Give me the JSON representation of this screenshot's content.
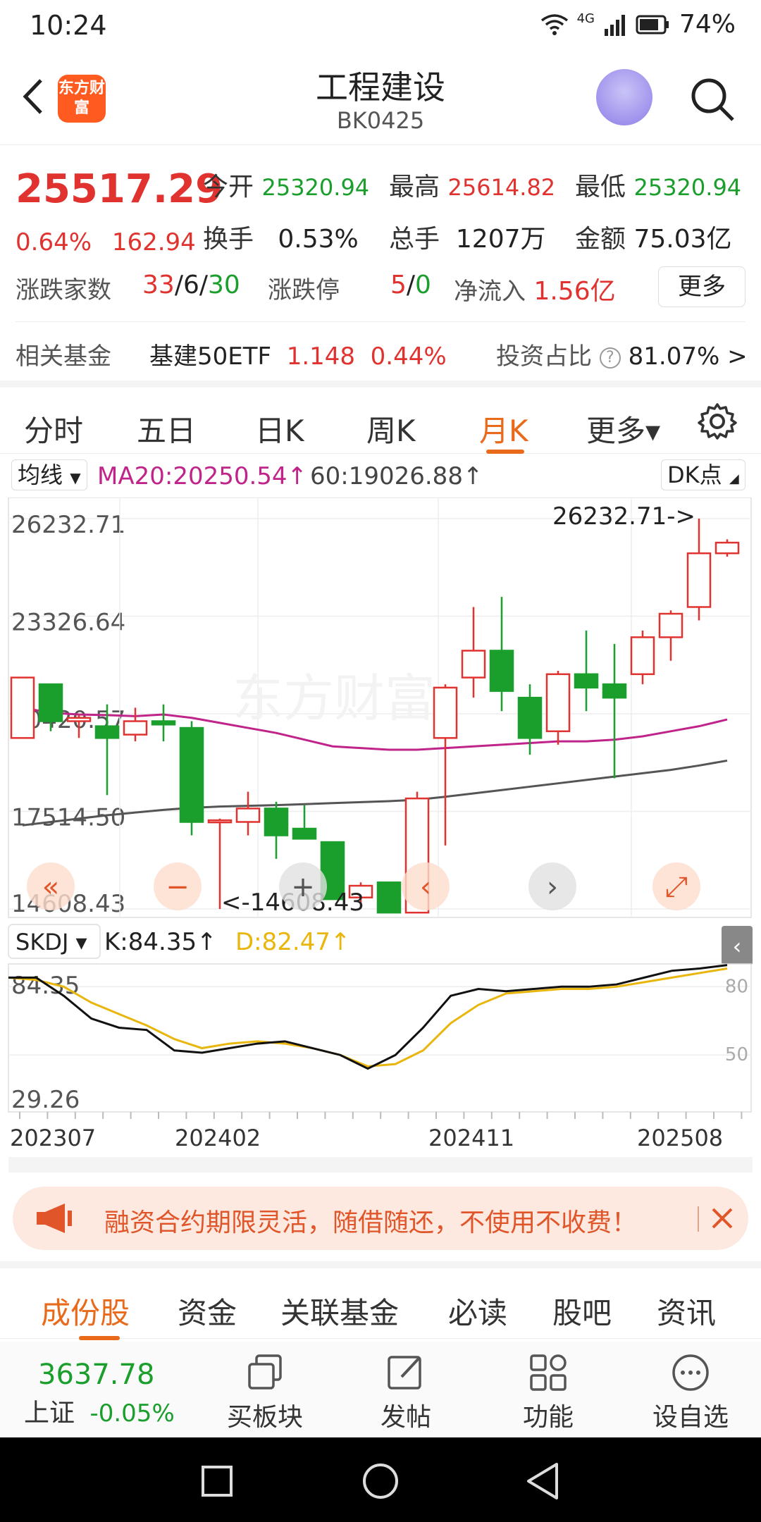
{
  "status": {
    "time": "10:24",
    "network": "4G",
    "battery": "74%"
  },
  "header": {
    "title": "工程建设",
    "code": "BK0425",
    "logo_text": "东方财富"
  },
  "quote": {
    "price": "25517.29",
    "change_pct": "0.64%",
    "change_abs": "162.94",
    "open_label": "今开",
    "open": "25320.94",
    "high_label": "最高",
    "high": "25614.82",
    "low_label": "最低",
    "low": "25320.94",
    "turnover_label": "换手",
    "turnover": "0.53%",
    "volume_label": "总手",
    "volume": "1207万",
    "amount_label": "金额",
    "amount": "75.03亿",
    "updown_label": "涨跌家数",
    "up": "33",
    "flat": "6",
    "down": "30",
    "limit_label": "涨跌停",
    "limit_up": "5",
    "limit_down": "0",
    "netflow_label": "净流入",
    "netflow": "1.56亿",
    "more_label": "更多",
    "fund_label": "相关基金",
    "fund_name": "基建50ETF",
    "fund_price": "1.148",
    "fund_pct": "0.44%",
    "invest_label": "投资占比",
    "invest_value": "81.07%"
  },
  "tabs": [
    "分时",
    "五日",
    "日K",
    "周K",
    "月K",
    "更多▾"
  ],
  "ma_bar": {
    "selector": "均线",
    "ma20": "MA20:20250.54↑",
    "ma60": "60:19026.88↑",
    "dk": "DK点"
  },
  "chart_data": {
    "type": "candlestick",
    "period": "monthly",
    "y_ticks": [
      "26232.71",
      "23326.64",
      "20420.57",
      "17514.50",
      "14608.43"
    ],
    "ylim": [
      14608.43,
      26232.71
    ],
    "x_labels": [
      "202307",
      "202402",
      "202411",
      "202508"
    ],
    "max_annotation": "26232.71->",
    "min_annotation": "<-14608.43",
    "watermark": "东方财富",
    "candles": [
      {
        "o": 19700,
        "h": 21500,
        "l": 19700,
        "c": 21500
      },
      {
        "o": 21300,
        "h": 21300,
        "l": 19900,
        "c": 20200
      },
      {
        "o": 20200,
        "h": 20400,
        "l": 19700,
        "c": 20300
      },
      {
        "o": 20050,
        "h": 20700,
        "l": 18000,
        "c": 19700
      },
      {
        "o": 19800,
        "h": 20600,
        "l": 19600,
        "c": 20200
      },
      {
        "o": 20200,
        "h": 20700,
        "l": 19600,
        "c": 20100
      },
      {
        "o": 20000,
        "h": 20200,
        "l": 16800,
        "c": 17200
      },
      {
        "o": 17200,
        "h": 17300,
        "l": 14608.43,
        "c": 17250
      },
      {
        "o": 17200,
        "h": 18100,
        "l": 16800,
        "c": 17600
      },
      {
        "o": 17600,
        "h": 17800,
        "l": 16100,
        "c": 16800
      },
      {
        "o": 17000,
        "h": 17700,
        "l": 16700,
        "c": 16700
      },
      {
        "o": 16600,
        "h": 16600,
        "l": 14900,
        "c": 14900
      },
      {
        "o": 14950,
        "h": 15400,
        "l": 14700,
        "c": 15300
      },
      {
        "o": 15400,
        "h": 15400,
        "l": 14700,
        "c": 14500
      },
      {
        "o": 14500,
        "h": 18100,
        "l": 14608.43,
        "c": 17900
      },
      {
        "o": 19700,
        "h": 21300,
        "l": 16500,
        "c": 21200
      },
      {
        "o": 21500,
        "h": 23600,
        "l": 20900,
        "c": 22300
      },
      {
        "o": 22300,
        "h": 23900,
        "l": 20500,
        "c": 21100
      },
      {
        "o": 20900,
        "h": 21300,
        "l": 19200,
        "c": 19700
      },
      {
        "o": 19900,
        "h": 21700,
        "l": 19500,
        "c": 21600
      },
      {
        "o": 21600,
        "h": 22900,
        "l": 20500,
        "c": 21200
      },
      {
        "o": 21300,
        "h": 22500,
        "l": 18500,
        "c": 20900
      },
      {
        "o": 21600,
        "h": 22900,
        "l": 21300,
        "c": 22700
      },
      {
        "o": 22700,
        "h": 23500,
        "l": 22000,
        "c": 23400
      },
      {
        "o": 23600,
        "h": 26232.71,
        "l": 23200,
        "c": 25200
      },
      {
        "o": 25200,
        "h": 25614.82,
        "l": 25100,
        "c": 25517.29
      }
    ],
    "ma20": [
      20600,
      20450,
      20400,
      20380,
      20350,
      20400,
      20300,
      20150,
      20000,
      19850,
      19650,
      19450,
      19400,
      19350,
      19350,
      19400,
      19450,
      19500,
      19550,
      19600,
      19600,
      19650,
      19750,
      19900,
      20050,
      20250.54
    ],
    "ma60": [
      17100,
      17200,
      17300,
      17400,
      17480,
      17560,
      17620,
      17660,
      17680,
      17700,
      17730,
      17760,
      17790,
      17820,
      17860,
      17950,
      18050,
      18150,
      18250,
      18350,
      18450,
      18550,
      18650,
      18750,
      18880,
      19026.88
    ],
    "indicator": {
      "name": "SKDJ",
      "k_label": "K:84.35↑",
      "d_label": "D:82.47↑",
      "top_value": "84.35",
      "bottom_value": "29.26",
      "ticks": [
        "80",
        "50"
      ],
      "ylim": [
        25,
        90
      ],
      "k": [
        84,
        84,
        76,
        66,
        62,
        61,
        52,
        51,
        53,
        55,
        56,
        53,
        50,
        44,
        50,
        62,
        76,
        79,
        78,
        79,
        80,
        80,
        81,
        84,
        87,
        88,
        89.5
      ],
      "d": [
        84,
        83,
        80,
        73,
        68,
        63,
        57,
        53,
        55,
        56,
        55,
        53,
        50,
        45,
        46,
        52,
        64,
        72,
        77,
        78,
        79,
        79,
        80,
        82,
        84,
        86,
        88
      ]
    }
  },
  "chart_controls": [
    "«",
    "−",
    "+",
    "‹",
    "›",
    "⤢"
  ],
  "banner": {
    "text": "融资合约期限灵活，随借随还，不使用不收费！"
  },
  "bottom_tabs": [
    "成份股",
    "资金",
    "关联基金",
    "必读",
    "股吧",
    "资讯"
  ],
  "index": {
    "value": "3637.78",
    "name": "上证",
    "pct": "-0.05%"
  },
  "toolbar": [
    "买板块",
    "发帖",
    "功能",
    "设自选"
  ],
  "colors": {
    "up": "#e0332f",
    "down": "#1a9e2c",
    "accent": "#e86a1a",
    "ma20": "#c0248a",
    "ma60": "#555555",
    "d_line": "#e8b60c"
  }
}
